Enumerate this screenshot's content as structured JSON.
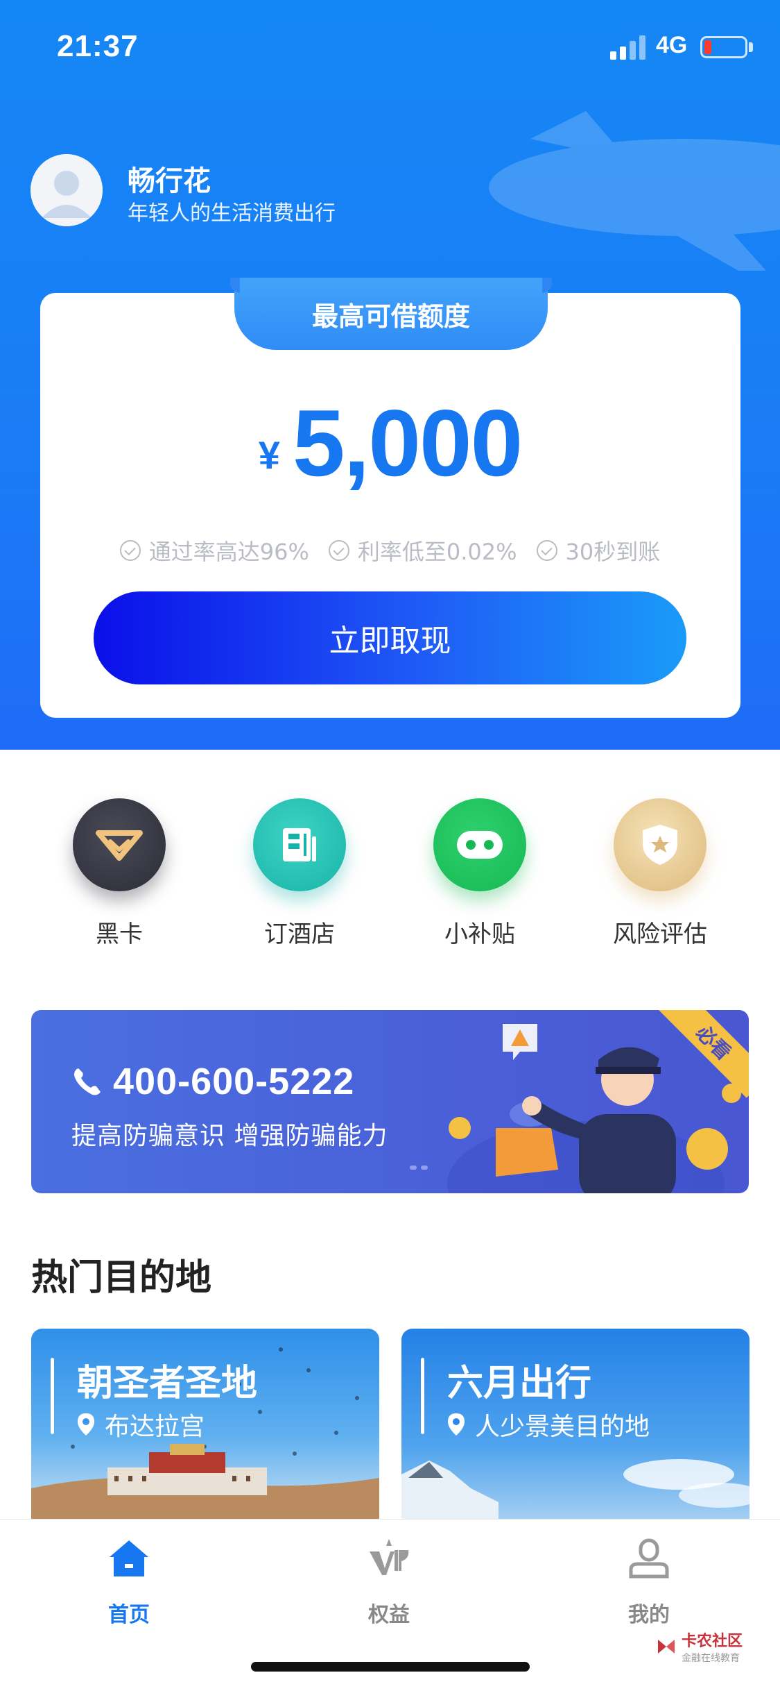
{
  "status_bar": {
    "time": "21:37",
    "network": "4G"
  },
  "profile": {
    "app_name": "畅行花",
    "slogan": "年轻人的生活消费出行"
  },
  "credit": {
    "tab_label": "最高可借额度",
    "currency": "¥",
    "amount": "5,000",
    "features": [
      "通过率高达96%",
      "利率低至0.02%",
      "30秒到账"
    ],
    "button_label": "立即取现"
  },
  "quick_actions": [
    {
      "label": "黑卡",
      "icon": "diamond-icon",
      "color": "#2b2c36"
    },
    {
      "label": "订酒店",
      "icon": "hotel-icon",
      "color": "#18b3a8"
    },
    {
      "label": "小补贴",
      "icon": "subsidy-icon",
      "color": "#16b854"
    },
    {
      "label": "风险评估",
      "icon": "shield-star-icon",
      "color": "#dcb87b"
    }
  ],
  "banner": {
    "phone": "400-600-5222",
    "tip": "提高防骗意识  增强防骗能力",
    "badge": "必看"
  },
  "section": {
    "title": "热门目的地"
  },
  "destinations": [
    {
      "title": "朝圣者圣地",
      "place": "布达拉宫"
    },
    {
      "title": "六月出行",
      "place": "人少景美目的地"
    }
  ],
  "tab_bar": {
    "home": "首页",
    "benefits": "权益",
    "mine": "我的"
  },
  "watermark": {
    "name": "卡农社区",
    "sub": "金融在线教育"
  },
  "colors": {
    "accent": "#1677f0",
    "hero": "#1a7cf6"
  }
}
